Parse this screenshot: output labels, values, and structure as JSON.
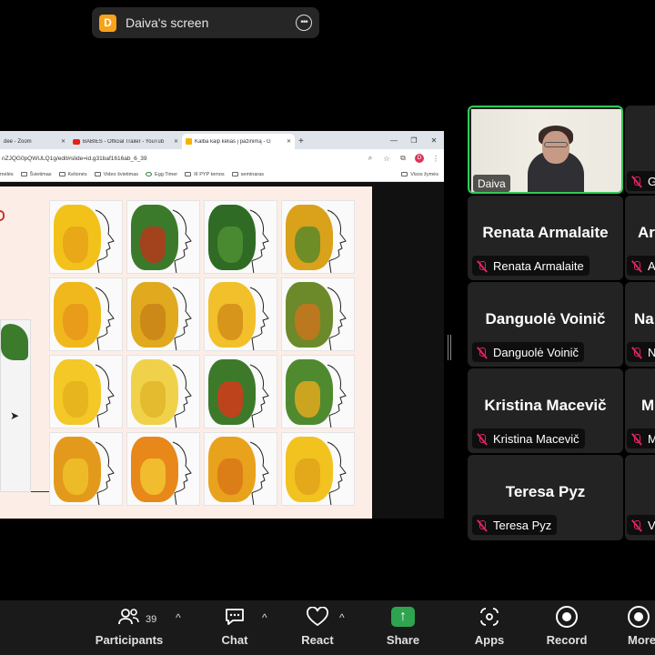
{
  "top_bar": {
    "avatar_letter": "D",
    "title": "Daiva's screen",
    "more_glyph": "•••"
  },
  "browser": {
    "tabs": [
      {
        "label": "dee - Zoom",
        "active": false
      },
      {
        "label": "BABIES - Official Trailer - YouTub",
        "active": false
      },
      {
        "label": "Kalba kaip kelias į pažinimą - G",
        "active": true
      }
    ],
    "new_tab": "+",
    "url": "nZJQG0pQWULQ1g/edit#slide=id.g31baf1616ab_6_39",
    "profile_letter": "D",
    "bookmarks": [
      "mėlės",
      "Švietimas",
      "Kelionės",
      "Video švietimas",
      "Egg Timer",
      "III PYP temos",
      "seminaras"
    ],
    "bookmarks_right": "Visos žymės"
  },
  "participants": [
    {
      "name": "Daiva",
      "video": true
    },
    {
      "name": "G",
      "video": false
    },
    {
      "big_name": "Renata Armalaite",
      "label": "Renata Armalaite"
    },
    {
      "big_name": "Ar",
      "label": "A"
    },
    {
      "big_name": "Danguolė Voinič",
      "label": "Danguolė Voinič"
    },
    {
      "big_name": "Na",
      "label": "N"
    },
    {
      "big_name": "Kristina Macevič",
      "label": "Kristina Macevič"
    },
    {
      "big_name": "M",
      "label": "M"
    },
    {
      "big_name": "Teresa Pyz",
      "label": "Teresa Pyz"
    },
    {
      "big_name": "",
      "label": "V"
    }
  ],
  "toolbar": {
    "participants_label": "Participants",
    "participants_count": "39",
    "chat_label": "Chat",
    "react_label": "React",
    "share_label": "Share",
    "apps_label": "Apps",
    "record_label": "Record",
    "more_label": "More",
    "chevron": "^"
  },
  "colors": {
    "active_speaker": "#34c759",
    "mic_off": "#e0245e",
    "share_green": "#2ea44f",
    "avatar_orange": "#f7a21b"
  }
}
